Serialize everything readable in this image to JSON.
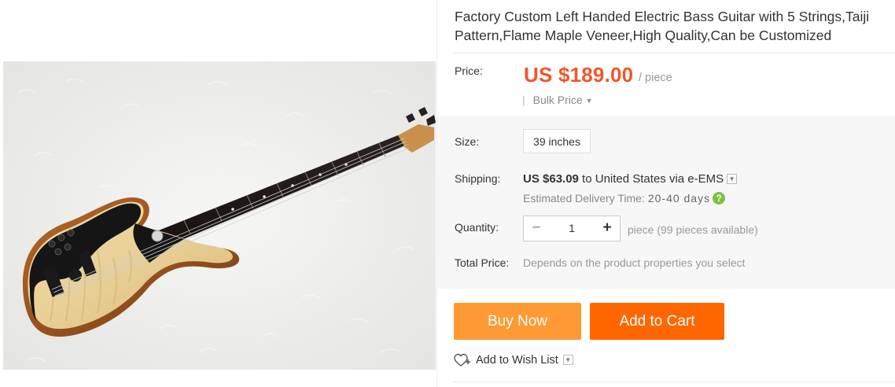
{
  "product": {
    "title": "Factory Custom Left Handed Electric Bass Guitar with 5 Strings,Taiji Pattern,Flame Maple Veneer,High Quality,Can be Customized",
    "image_alt": "Left handed electric bass guitar on white fur"
  },
  "price": {
    "label": "Price:",
    "value": "US $189.00",
    "unit": "/ piece",
    "bulk_label": "Bulk Price"
  },
  "size": {
    "label": "Size:",
    "selected": "39 inches"
  },
  "shipping": {
    "label": "Shipping:",
    "cost": "US $63.09",
    "destination_text": " to United States via e-EMS",
    "eta_label": "Estimated Delivery Time:",
    "eta_value": "20-40 days",
    "help_glyph": "?"
  },
  "quantity": {
    "label": "Quantity:",
    "value": "1",
    "minus": "−",
    "plus": "+",
    "availability": "piece (99 pieces available)"
  },
  "total": {
    "label": "Total Price:",
    "note": "Depends on the product properties you select"
  },
  "actions": {
    "buy_now": "Buy Now",
    "add_to_cart": "Add to Cart",
    "wish_list": "Add to Wish List"
  },
  "colors": {
    "price": "#f0562a",
    "buy_now": "#ff9933",
    "add_to_cart": "#ff6600",
    "help_badge": "#7bc242"
  },
  "icons": [
    "chevron-down-icon",
    "question-icon",
    "heart-plus-icon"
  ]
}
